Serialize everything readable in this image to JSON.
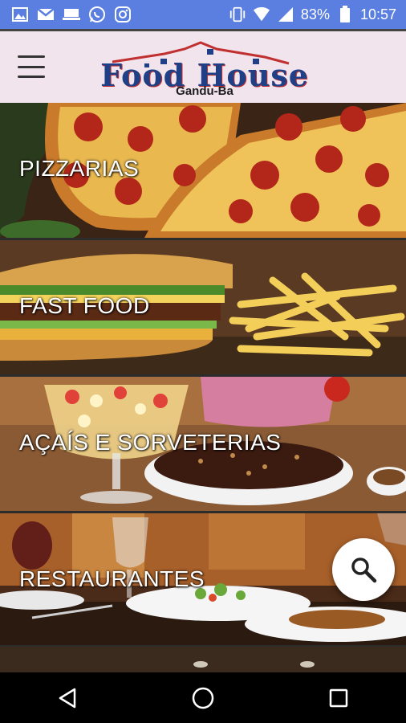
{
  "status_bar": {
    "battery_percent": "83%",
    "time": "10:57",
    "left_icons": [
      "gallery-icon",
      "gmail-icon",
      "storage-icon",
      "whatsapp-icon",
      "instagram-icon"
    ],
    "right_icons": [
      "vibrate-icon",
      "wifi-icon",
      "signal-icon",
      "battery-icon"
    ]
  },
  "header": {
    "logo_title": "Food House",
    "logo_subtitle": "Gandu-Ba",
    "menu_icon": "hamburger-menu-icon"
  },
  "categories": [
    {
      "label": "PIZZARIAS",
      "image": "pizza-photo"
    },
    {
      "label": "FAST FOOD",
      "image": "burger-fries-photo"
    },
    {
      "label": "AÇAÍS E SORVETERIAS",
      "image": "acai-dessert-photo"
    },
    {
      "label": "RESTAURANTES",
      "image": "restaurant-table-photo"
    }
  ],
  "fab": {
    "icon": "search-icon"
  },
  "nav": {
    "back": "back-icon",
    "home": "home-icon",
    "recents": "recents-icon"
  },
  "colors": {
    "status_bar": "#5b7fe0",
    "header_bg": "#f1e4ec",
    "logo_blue": "#1f3f86",
    "logo_red": "#c03030"
  }
}
